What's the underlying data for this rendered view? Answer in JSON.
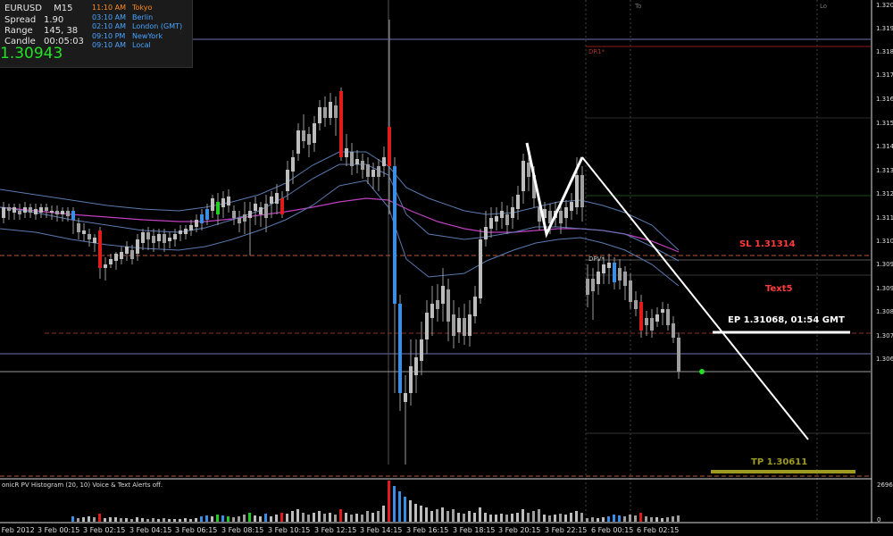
{
  "info_panel": {
    "symbol": "EURUSD",
    "timeframe": "M15",
    "spread_label": "Spread",
    "spread_value": "1.90",
    "range_label": "Range",
    "range_value": "145, 38",
    "candle_label": "Candle",
    "candle_value": "00:05:03",
    "current_price": "1.30943",
    "timezones": [
      {
        "time": "11:10 AM",
        "name": "Tokyo",
        "color": "#ff8c1a"
      },
      {
        "time": "03:10 AM",
        "name": "Berlin",
        "color": "#4aa3ff"
      },
      {
        "time": "02:10 AM",
        "name": "London  (GMT)",
        "color": "#4aa3ff"
      },
      {
        "time": "09:10 PM",
        "name": "NewYork",
        "color": "#4aa3ff"
      },
      {
        "time": "09:10 AM",
        "name": "Local",
        "color": "#4aa3ff"
      }
    ]
  },
  "annotations": {
    "sl": "SL 1.31314",
    "text5": "Text5",
    "ep": "EP 1.31068, 01:54 GMT",
    "tp": "TP 1.30611",
    "dr1": "DR1*",
    "dpv": "DPV*",
    "to": "To",
    "lo": "Lo"
  },
  "price_axis": {
    "labels": [
      "1.320",
      "1.319",
      "1.318",
      "1.317",
      "1.316",
      "1.315",
      "1.314",
      "1.313",
      "1.312",
      "1.311",
      "1.310",
      "1.309",
      "1.309",
      "1.308",
      "1.307",
      "1.306"
    ]
  },
  "time_axis": {
    "labels": [
      "2 Feb 2012",
      "3 Feb 00:15",
      "3 Feb 02:15",
      "3 Feb 04:15",
      "3 Feb 06:15",
      "3 Feb 08:15",
      "3 Feb 10:15",
      "3 Feb 12:15",
      "3 Feb 14:15",
      "3 Feb 16:15",
      "3 Feb 18:15",
      "3 Feb 20:15",
      "3 Feb 22:15",
      "6 Feb 00:15",
      "6 Feb 02:15"
    ]
  },
  "indicator": {
    "label": "onicR PV Histogram  (20, 10)    Voice & Text Alerts off.",
    "max_value": "2696.",
    "zero_value": "0"
  },
  "colors": {
    "bull": "#bdbdbd",
    "bear": "#9e9e9e",
    "climax_up": "#e01b1b",
    "climax_down": "#3a8ee6",
    "rising": "#1fcc1f",
    "sl": "#ff3b3b",
    "tp": "#9e9a1f",
    "ep": "#ffffff"
  }
}
